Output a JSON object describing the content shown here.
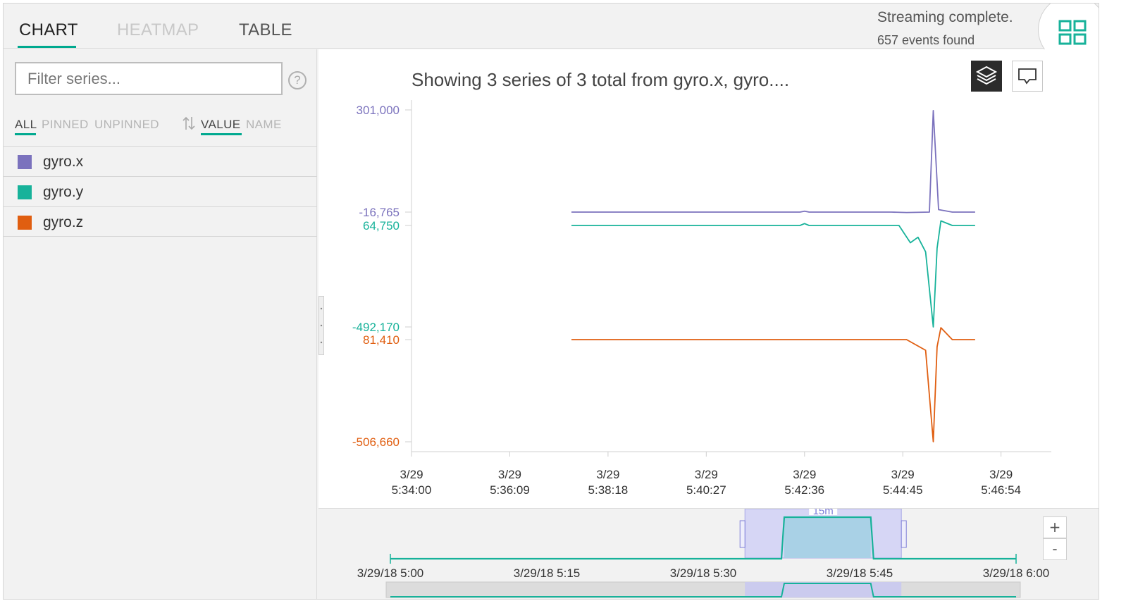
{
  "tabs": [
    {
      "label": "CHART",
      "state": "active"
    },
    {
      "label": "HEATMAP",
      "state": "disabled"
    },
    {
      "label": "TABLE",
      "state": "inactive"
    }
  ],
  "status": {
    "title": "Streaming complete.",
    "count": "657 events found"
  },
  "sidebar": {
    "filter_placeholder": "Filter series...",
    "help": "?",
    "filters": [
      "ALL",
      "PINNED",
      "UNPINNED"
    ],
    "sort": [
      "VALUE",
      "NAME"
    ],
    "series": [
      {
        "name": "gyro.x",
        "color": "#7b72bd"
      },
      {
        "name": "gyro.y",
        "color": "#17b29a"
      },
      {
        "name": "gyro.z",
        "color": "#e05e10"
      }
    ]
  },
  "chart": {
    "title": "Showing 3 series of 3 total from gyro.x, gyro...."
  },
  "chart_data": {
    "type": "line",
    "title": "Showing 3 series of 3 total from gyro.x, gyro....",
    "x_ticks": [
      "3/29 5:34:00",
      "3/29 5:36:09",
      "3/29 5:38:18",
      "3/29 5:40:27",
      "3/29 5:42:36",
      "3/29 5:44:45",
      "3/29 5:46:54"
    ],
    "x_range": [
      "3/29 5:34:00",
      "3/29 5:48:00"
    ],
    "grid": false,
    "series": [
      {
        "name": "gyro.x",
        "color": "#7b72bd",
        "y_axis_labels": [
          "301,000",
          "-16,765"
        ],
        "y_range": [
          -16765,
          301000
        ],
        "x": [
          "5:37:30",
          "5:42:30",
          "5:42:36",
          "5:42:42",
          "5:44:30",
          "5:44:50",
          "5:45:20",
          "5:45:25",
          "5:45:32",
          "5:45:50",
          "5:46:20"
        ],
        "values": [
          -16765,
          -16765,
          -14000,
          -16765,
          -16765,
          -18000,
          -16765,
          299000,
          -9000,
          -16765,
          -16765
        ]
      },
      {
        "name": "gyro.y",
        "color": "#17b29a",
        "y_axis_labels": [
          "64,750",
          "-492,170"
        ],
        "y_range": [
          -492170,
          64750
        ],
        "x": [
          "5:37:30",
          "5:42:30",
          "5:42:36",
          "5:42:42",
          "5:44:40",
          "5:44:55",
          "5:45:05",
          "5:45:15",
          "5:45:25",
          "5:45:30",
          "5:45:35",
          "5:45:50",
          "5:46:20"
        ],
        "values": [
          64750,
          64750,
          75000,
          64750,
          64750,
          -30000,
          0,
          -80000,
          -492000,
          -60000,
          90000,
          64750,
          64750
        ]
      },
      {
        "name": "gyro.z",
        "color": "#e05e10",
        "y_axis_labels": [
          "81,410",
          "-506,660"
        ],
        "y_range": [
          -506660,
          81410
        ],
        "x": [
          "5:37:30",
          "5:44:50",
          "5:45:15",
          "5:45:25",
          "5:45:30",
          "5:45:35",
          "5:45:50",
          "5:46:20"
        ],
        "values": [
          81410,
          81410,
          20000,
          -506000,
          40000,
          150000,
          81410,
          81410
        ]
      }
    ]
  },
  "timeline": {
    "ticks": [
      "3/29/18 5:00",
      "3/29/18 5:15",
      "3/29/18 5:30",
      "3/29/18 5:45",
      "3/29/18 6:00"
    ],
    "window_label": "15m",
    "zoom_in": "+",
    "zoom_out": "-",
    "window_range": [
      "3/29/18 5:34",
      "3/29/18 5:49"
    ]
  }
}
